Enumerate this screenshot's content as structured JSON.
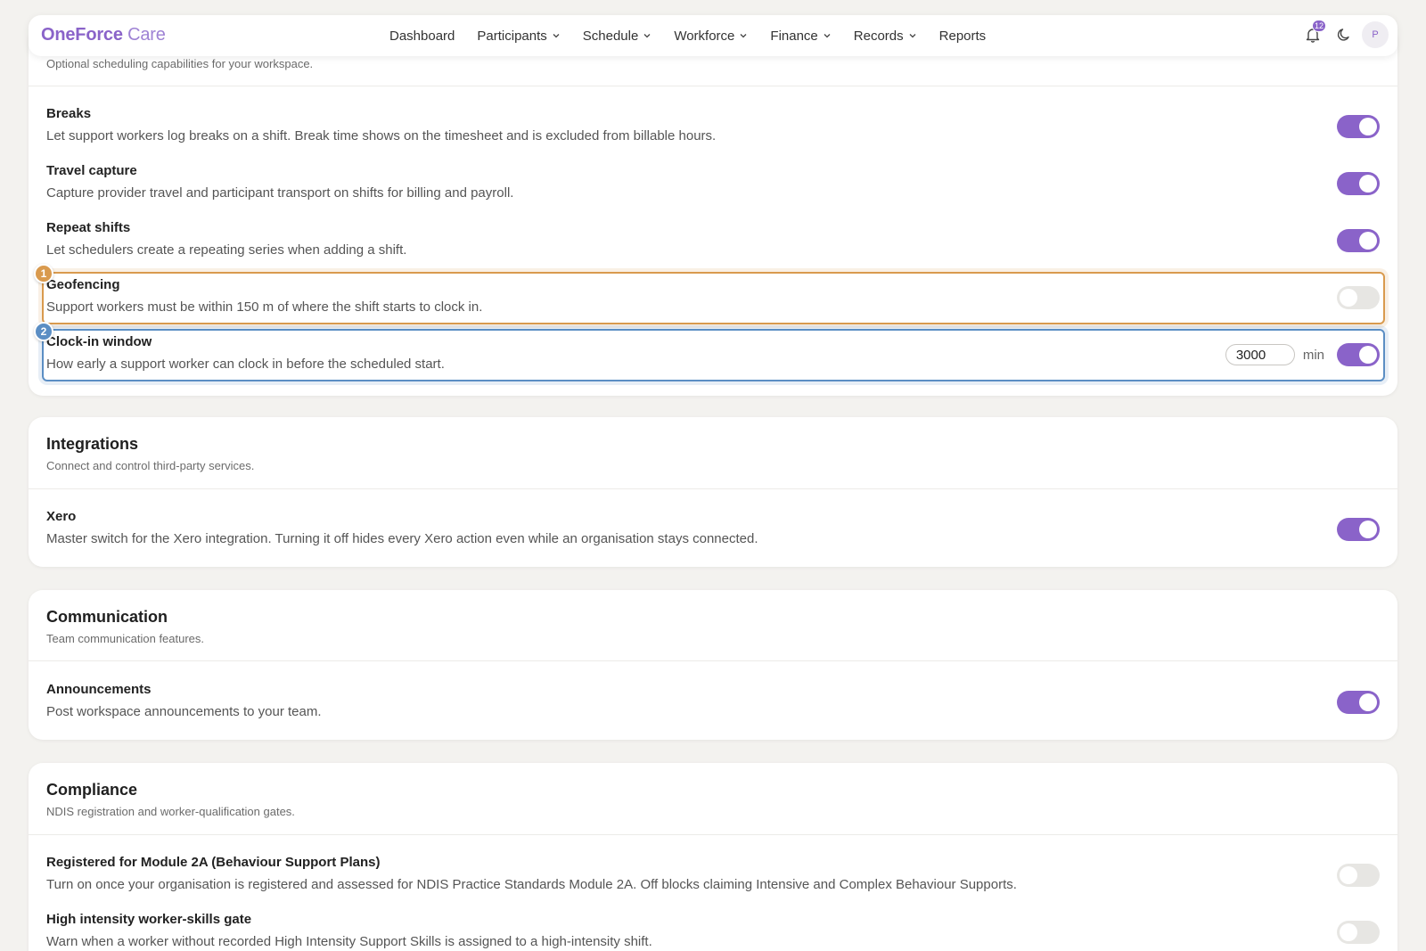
{
  "brand": {
    "part1": "OneForce",
    "part2": " Care"
  },
  "nav": [
    {
      "label": "Dashboard",
      "dropdown": false
    },
    {
      "label": "Participants",
      "dropdown": true
    },
    {
      "label": "Schedule",
      "dropdown": true
    },
    {
      "label": "Workforce",
      "dropdown": true
    },
    {
      "label": "Finance",
      "dropdown": true
    },
    {
      "label": "Records",
      "dropdown": true
    },
    {
      "label": "Reports",
      "dropdown": false
    }
  ],
  "notifications": {
    "count": "12"
  },
  "avatar": {
    "initial": "P"
  },
  "scheduling": {
    "subtitle": "Optional scheduling capabilities for your workspace.",
    "items": [
      {
        "title": "Breaks",
        "desc": "Let support workers log breaks on a shift. Break time shows on the timesheet and is excluded from billable hours.",
        "on": true
      },
      {
        "title": "Travel capture",
        "desc": "Capture provider travel and participant transport on shifts for billing and payroll.",
        "on": true
      },
      {
        "title": "Repeat shifts",
        "desc": "Let schedulers create a repeating series when adding a shift.",
        "on": true
      },
      {
        "title": "Geofencing",
        "desc": "Support workers must be within 150 m of where the shift starts to clock in.",
        "on": false
      },
      {
        "title": "Clock-in window",
        "desc": "How early a support worker can clock in before the scheduled start.",
        "on": true,
        "value": "3000",
        "unit": "min"
      }
    ]
  },
  "markers": [
    "1",
    "2"
  ],
  "integrations": {
    "title": "Integrations",
    "subtitle": "Connect and control third-party services.",
    "items": [
      {
        "title": "Xero",
        "desc": "Master switch for the Xero integration. Turning it off hides every Xero action even while an organisation stays connected.",
        "on": true
      }
    ]
  },
  "communication": {
    "title": "Communication",
    "subtitle": "Team communication features.",
    "items": [
      {
        "title": "Announcements",
        "desc": "Post workspace announcements to your team.",
        "on": true
      }
    ]
  },
  "compliance": {
    "title": "Compliance",
    "subtitle": "NDIS registration and worker-qualification gates.",
    "items": [
      {
        "title": "Registered for Module 2A (Behaviour Support Plans)",
        "desc": "Turn on once your organisation is registered and assessed for NDIS Practice Standards Module 2A. Off blocks claiming Intensive and Complex Behaviour Supports.",
        "on": false
      },
      {
        "title": "High intensity worker-skills gate",
        "desc": "Warn when a worker without recorded High Intensity Support Skills is assigned to a high-intensity shift.",
        "on": false
      }
    ]
  },
  "colors": {
    "accent": "#8a63c9",
    "highlight1": "#d99a4e",
    "highlight2": "#5b8ec4"
  }
}
